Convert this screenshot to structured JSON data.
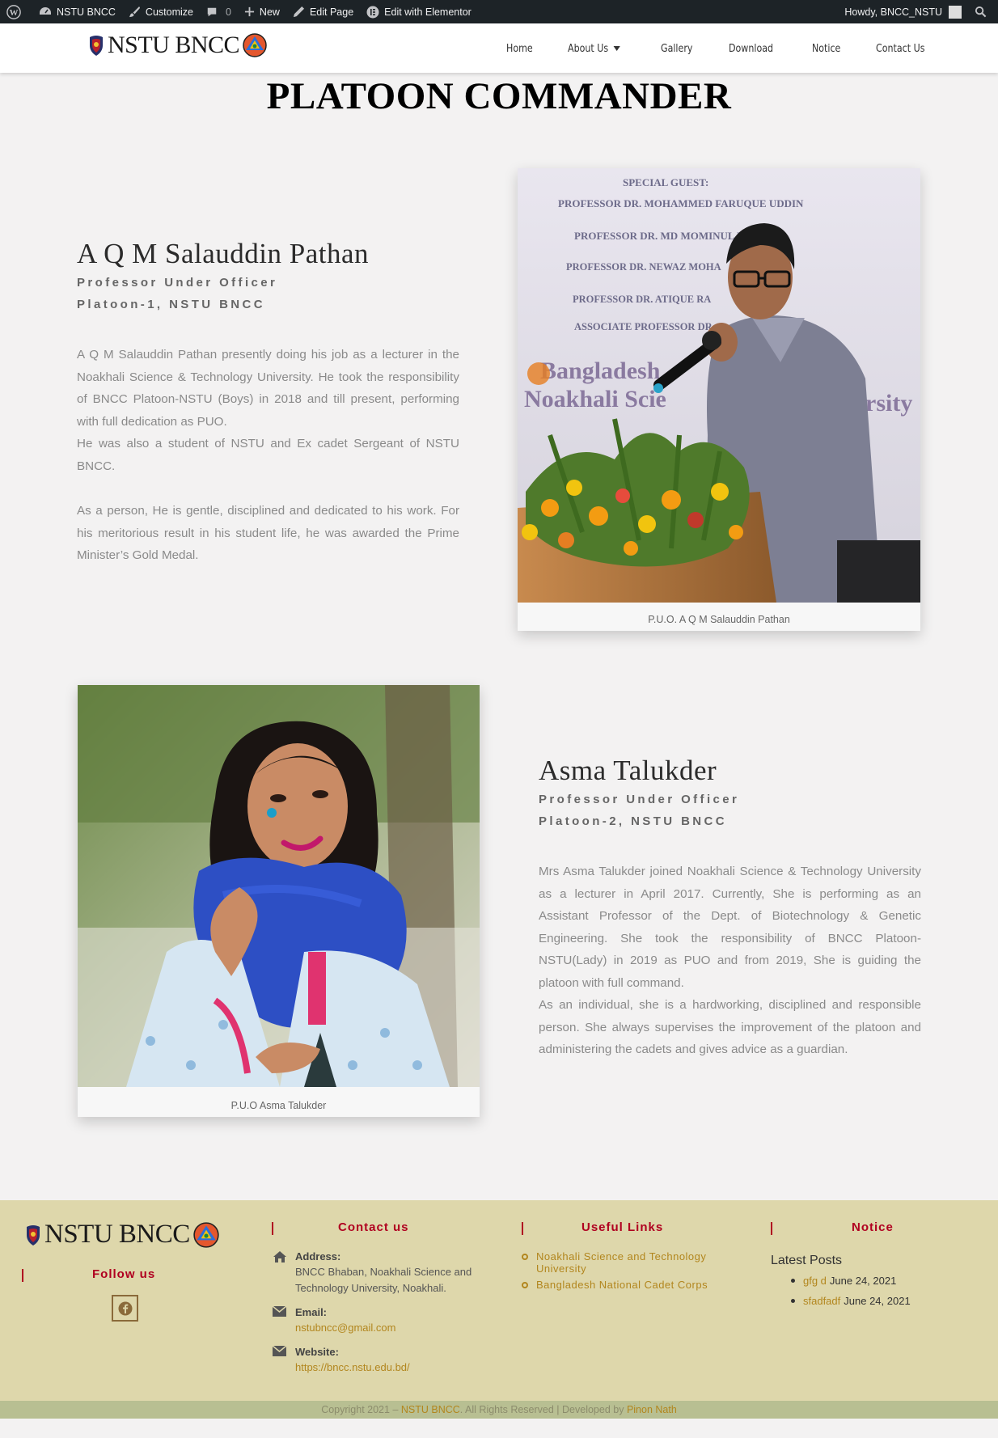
{
  "admin_bar": {
    "site_name": "NSTU BNCC",
    "customize": "Customize",
    "comments_count": "0",
    "new": "New",
    "edit_page": "Edit Page",
    "edit_elementor": "Edit with Elementor",
    "howdy": "Howdy, BNCC_NSTU"
  },
  "header": {
    "logo_text": "NSTU BNCC",
    "nav": [
      {
        "label": "Home"
      },
      {
        "label": "About Us"
      },
      {
        "label": "Gallery"
      },
      {
        "label": "Download"
      },
      {
        "label": "Notice"
      },
      {
        "label": "Contact Us"
      }
    ]
  },
  "page": {
    "title": "PLATOON COMMANDER",
    "people": [
      {
        "name": "A Q M Salauddin Pathan",
        "role1": "Professor Under Officer",
        "role2": "Platoon-1, NSTU BNCC",
        "bio1": "A Q M Salauddin Pathan presently doing his job as a lecturer in the Noakhali Science & Technology University. He took the responsibility of BNCC Platoon-NSTU (Boys) in 2018 and till present, performing with full dedication as PUO.",
        "bio2": "He was also a student of NSTU and Ex cadet Sergeant of NSTU BNCC.",
        "bio3": "As a person, He is gentle, disciplined and dedicated to his work. For his meritorious result in his student life, he was awarded the Prime Minister’s Gold Medal.",
        "caption": "P.U.O. A Q M Salauddin Pathan"
      },
      {
        "name": "Asma Talukder",
        "role1": "Professor Under Officer",
        "role2": "Platoon-2, NSTU BNCC",
        "bio1": "Mrs Asma Talukder joined Noakhali Science & Technology University as a lecturer in April 2017. Currently, She is performing as an Assistant Professor of the Dept. of Biotechnology & Genetic Engineering. She took the responsibility of BNCC Platoon-NSTU(Lady) in 2019 as PUO and from 2019, She is guiding the platoon with full command.",
        "bio2": "As an individual, she is a hardworking, disciplined and responsible person. She always supervises the improvement of the platoon and administering the cadets and gives advice as a guardian.",
        "caption": "P.U.O Asma Talukder"
      }
    ],
    "photo1_text": {
      "l1": "SPECIAL GUEST:",
      "l2": "PROFESSOR DR. MOHAMMED FARUQUE UDDIN",
      "l3": "PROFESSOR DR. MD MOMINUL HAQUE",
      "l4": "PROFESSOR DR. NEWAZ MOHA",
      "l5": "PROFESSOR DR. ATIQUE RA",
      "l6": "ASSOCIATE PROFESSOR DR.",
      "l7": "Bangladesh",
      "l8": "Noakhali Scie",
      "l9": "rsity"
    }
  },
  "footer": {
    "logo_text": "NSTU BNCC",
    "follow_us": "Follow us",
    "contact_heading": "Contact us",
    "address_label": "Address:",
    "address": "BNCC Bhaban, Noakhali Science and Technology University, Noakhali.",
    "email_label": "Email:",
    "email": "nstubncc@gmail.com",
    "website_label": "Website:",
    "website": "https://bncc.nstu.edu.bd/",
    "useful_heading": "Useful Links",
    "useful_links": [
      {
        "label": "Noakhali Science and Technology University"
      },
      {
        "label": "Bangladesh National Cadet Corps"
      }
    ],
    "notice_heading": "Notice",
    "latest_posts": "Latest Posts",
    "posts": [
      {
        "title": "gfg d",
        "date": "June 24, 2021"
      },
      {
        "title": "sfadfadf",
        "date": "June 24, 2021"
      }
    ],
    "copyright_prefix": "Copyright 2021 –",
    "copyright_site": "NSTU BNCC",
    "copyright_mid": ". All Rights Reserved | Developed by",
    "copyright_dev": "Pinon Nath"
  },
  "colors": {
    "admin_bar": "#1d2327",
    "footer_bg": "#ded7ab",
    "accent_red": "#b00020",
    "link_gold": "#b2861e"
  }
}
